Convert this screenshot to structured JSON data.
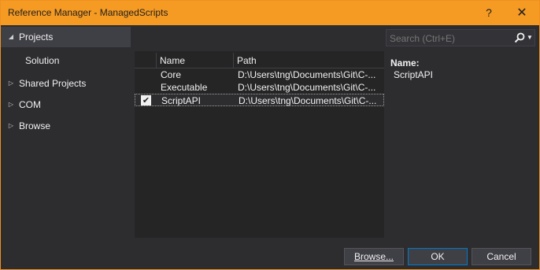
{
  "window": {
    "title": "Reference Manager - ManagedScripts",
    "help_label": "?",
    "close_label": "✕"
  },
  "nav": {
    "items": [
      {
        "label": "Projects",
        "expanded": true,
        "selected": true
      },
      {
        "label": "Solution",
        "sub": true
      },
      {
        "label": "Shared Projects",
        "expanded": false
      },
      {
        "label": "COM",
        "expanded": false
      },
      {
        "label": "Browse",
        "expanded": false
      }
    ]
  },
  "search": {
    "placeholder": "Search (Ctrl+E)"
  },
  "grid": {
    "columns": [
      "Name",
      "Path"
    ],
    "rows": [
      {
        "name": "Core",
        "path": "D:\\Users\\tng\\Documents\\Git\\C-...",
        "checked": false,
        "selected": false
      },
      {
        "name": "Executable",
        "path": "D:\\Users\\tng\\Documents\\Git\\C-...",
        "checked": false,
        "selected": false
      },
      {
        "name": "ScriptAPI",
        "path": "D:\\Users\\tng\\Documents\\Git\\C-...",
        "checked": true,
        "selected": true
      }
    ]
  },
  "details": {
    "name_label": "Name:",
    "name_value": "ScriptAPI"
  },
  "buttons": {
    "browse_label": "Browse...",
    "ok_label": "OK",
    "cancel_label": "Cancel"
  },
  "colors": {
    "accent": "#f59a23",
    "background": "#2d2d30",
    "panel": "#252526",
    "focus": "#007acc"
  }
}
